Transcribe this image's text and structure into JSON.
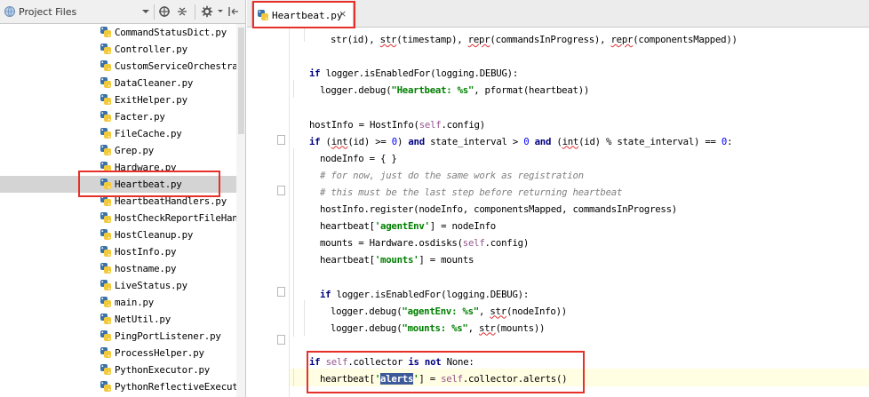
{
  "project_panel": {
    "title": "Project Files",
    "toolbar_icons": [
      "globe-icon",
      "chevron-down-icon",
      "target-icon",
      "collapse-all-icon",
      "gear-icon",
      "hide-panel-icon"
    ],
    "files": [
      {
        "name": "CommandStatusDict.py",
        "selected": false
      },
      {
        "name": "Controller.py",
        "selected": false
      },
      {
        "name": "CustomServiceOrchestrator",
        "selected": false
      },
      {
        "name": "DataCleaner.py",
        "selected": false
      },
      {
        "name": "ExitHelper.py",
        "selected": false
      },
      {
        "name": "Facter.py",
        "selected": false
      },
      {
        "name": "FileCache.py",
        "selected": false
      },
      {
        "name": "Grep.py",
        "selected": false
      },
      {
        "name": "Hardware.py",
        "selected": false
      },
      {
        "name": "Heartbeat.py",
        "selected": true
      },
      {
        "name": "HeartbeatHandlers.py",
        "selected": false
      },
      {
        "name": "HostCheckReportFileHandle",
        "selected": false
      },
      {
        "name": "HostCleanup.py",
        "selected": false
      },
      {
        "name": "HostInfo.py",
        "selected": false
      },
      {
        "name": "hostname.py",
        "selected": false
      },
      {
        "name": "LiveStatus.py",
        "selected": false
      },
      {
        "name": "main.py",
        "selected": false
      },
      {
        "name": "NetUtil.py",
        "selected": false
      },
      {
        "name": "PingPortListener.py",
        "selected": false
      },
      {
        "name": "ProcessHelper.py",
        "selected": false
      },
      {
        "name": "PythonExecutor.py",
        "selected": false
      },
      {
        "name": "PythonReflectiveExecutor.",
        "selected": false
      }
    ]
  },
  "editor": {
    "active_tab": "Heartbeat.py",
    "close_glyph": "×",
    "code_lines": [
      {
        "type": "tokens",
        "indent": 24,
        "tokens": [
          {
            "c": "",
            "t": "str"
          },
          {
            "c": "",
            "t": "(id), "
          },
          {
            "c": "err",
            "t": "str"
          },
          {
            "c": "",
            "t": "(timestamp), "
          },
          {
            "c": "err",
            "t": "repr"
          },
          {
            "c": "",
            "t": "(commandsInProgress), "
          },
          {
            "c": "err",
            "t": "repr"
          },
          {
            "c": "",
            "t": "(componentsMapped))"
          }
        ]
      },
      {
        "type": "blank"
      },
      {
        "type": "tokens",
        "indent": 0,
        "tokens": [
          {
            "c": "kw",
            "t": "if"
          },
          {
            "c": "",
            "t": " logger.isEnabledFor(logging.DEBUG):"
          }
        ]
      },
      {
        "type": "tokens",
        "indent": 12,
        "tokens": [
          {
            "c": "",
            "t": "logger.debug("
          },
          {
            "c": "str",
            "t": "\"Heartbeat: %s\""
          },
          {
            "c": "",
            "t": ", pformat(heartbeat))"
          }
        ]
      },
      {
        "type": "blank"
      },
      {
        "type": "tokens",
        "indent": 0,
        "tokens": [
          {
            "c": "",
            "t": "hostInfo = HostInfo("
          },
          {
            "c": "self",
            "t": "self"
          },
          {
            "c": "",
            "t": ".config)"
          }
        ]
      },
      {
        "type": "tokens",
        "indent": 0,
        "tokens": [
          {
            "c": "kw",
            "t": "if"
          },
          {
            "c": "",
            "t": " ("
          },
          {
            "c": "err",
            "t": "int"
          },
          {
            "c": "",
            "t": "(id) >= "
          },
          {
            "c": "num",
            "t": "0"
          },
          {
            "c": "",
            "t": ") "
          },
          {
            "c": "kw",
            "t": "and"
          },
          {
            "c": "",
            "t": " state_interval > "
          },
          {
            "c": "num",
            "t": "0"
          },
          {
            "c": "",
            "t": " "
          },
          {
            "c": "kw",
            "t": "and"
          },
          {
            "c": "",
            "t": " ("
          },
          {
            "c": "err",
            "t": "int"
          },
          {
            "c": "",
            "t": "(id) % state_interval) == "
          },
          {
            "c": "num",
            "t": "0"
          },
          {
            "c": "",
            "t": ":"
          }
        ]
      },
      {
        "type": "tokens",
        "indent": 12,
        "tokens": [
          {
            "c": "",
            "t": "nodeInfo = { }"
          }
        ]
      },
      {
        "type": "tokens",
        "indent": 12,
        "tokens": [
          {
            "c": "cmt",
            "t": "# for now, just do the same work as registration"
          }
        ]
      },
      {
        "type": "tokens",
        "indent": 12,
        "tokens": [
          {
            "c": "cmt",
            "t": "# this must be the last step before returning heartbeat"
          }
        ]
      },
      {
        "type": "tokens",
        "indent": 12,
        "tokens": [
          {
            "c": "",
            "t": "hostInfo.register(nodeInfo, componentsMapped, commandsInProgress)"
          }
        ]
      },
      {
        "type": "tokens",
        "indent": 12,
        "tokens": [
          {
            "c": "",
            "t": "heartbeat["
          },
          {
            "c": "str",
            "t": "'agentEnv'"
          },
          {
            "c": "",
            "t": "] = nodeInfo"
          }
        ]
      },
      {
        "type": "tokens",
        "indent": 12,
        "tokens": [
          {
            "c": "",
            "t": "mounts = Hardware.osdisks("
          },
          {
            "c": "self",
            "t": "self"
          },
          {
            "c": "",
            "t": ".config)"
          }
        ]
      },
      {
        "type": "tokens",
        "indent": 12,
        "tokens": [
          {
            "c": "",
            "t": "heartbeat["
          },
          {
            "c": "str",
            "t": "'mounts'"
          },
          {
            "c": "",
            "t": "] = mounts"
          }
        ]
      },
      {
        "type": "blank"
      },
      {
        "type": "tokens",
        "indent": 12,
        "tokens": [
          {
            "c": "kw",
            "t": "if"
          },
          {
            "c": "",
            "t": " logger.isEnabledFor(logging.DEBUG):"
          }
        ]
      },
      {
        "type": "tokens",
        "indent": 24,
        "tokens": [
          {
            "c": "",
            "t": "logger.debug("
          },
          {
            "c": "str",
            "t": "\"agentEnv: %s\""
          },
          {
            "c": "",
            "t": ", "
          },
          {
            "c": "err",
            "t": "str"
          },
          {
            "c": "",
            "t": "(nodeInfo))"
          }
        ]
      },
      {
        "type": "tokens",
        "indent": 24,
        "tokens": [
          {
            "c": "",
            "t": "logger.debug("
          },
          {
            "c": "str",
            "t": "\"mounts: %s\""
          },
          {
            "c": "",
            "t": ", "
          },
          {
            "c": "err",
            "t": "str"
          },
          {
            "c": "",
            "t": "(mounts))"
          }
        ]
      },
      {
        "type": "blank"
      },
      {
        "type": "tokens",
        "indent": 0,
        "tokens": [
          {
            "c": "kw",
            "t": "if"
          },
          {
            "c": "",
            "t": " "
          },
          {
            "c": "self",
            "t": "self"
          },
          {
            "c": "",
            "t": ".collector "
          },
          {
            "c": "kw",
            "t": "is not"
          },
          {
            "c": "",
            "t": " None:"
          }
        ]
      },
      {
        "type": "tokens",
        "indent": 12,
        "tokens": [
          {
            "c": "",
            "t": "heartbeat["
          },
          {
            "c": "str",
            "t": "'"
          },
          {
            "c": "sel",
            "t": "alerts"
          },
          {
            "c": "str",
            "t": "'"
          },
          {
            "c": "",
            "t": "] = "
          },
          {
            "c": "self",
            "t": "self"
          },
          {
            "c": "",
            "t": ".collector.alerts()"
          }
        ]
      }
    ]
  }
}
